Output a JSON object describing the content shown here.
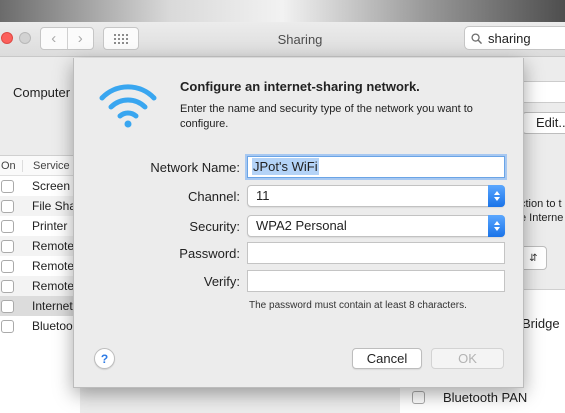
{
  "window": {
    "title": "Sharing",
    "search_value": "sharing"
  },
  "background": {
    "computer_label": "Computer",
    "edit_button": "Edit...",
    "services_header": {
      "on": "On",
      "service": "Service"
    },
    "services": [
      {
        "name": "Screen",
        "checked": false
      },
      {
        "name": "File Sha",
        "checked": false
      },
      {
        "name": "Printer",
        "checked": false
      },
      {
        "name": "Remote",
        "checked": false
      },
      {
        "name": "Remote",
        "checked": false
      },
      {
        "name": "Remote",
        "checked": false
      },
      {
        "name": "Internet",
        "checked": false,
        "selected": true
      },
      {
        "name": "Bluetoo",
        "checked": false
      }
    ],
    "right_text_1": "ction to t",
    "right_text_2": "e Interne",
    "right_list": [
      {
        "label": "Bridge"
      },
      {
        "label": "Bluetooth PAN"
      }
    ]
  },
  "dialog": {
    "title": "Configure an internet-sharing network.",
    "description": "Enter the name and security type of the network you want to configure.",
    "fields": {
      "network_name_label": "Network Name:",
      "network_name_value": "JPot's WiFi",
      "channel_label": "Channel:",
      "channel_value": "11",
      "security_label": "Security:",
      "security_value": "WPA2 Personal",
      "password_label": "Password:",
      "password_value": "",
      "verify_label": "Verify:",
      "verify_value": ""
    },
    "hint": "The password must contain at least 8 characters.",
    "help_label": "?",
    "cancel_label": "Cancel",
    "ok_label": "OK"
  },
  "colors": {
    "accent": "#1a73e8",
    "wifi_icon": "#39a6f0",
    "close_button": "#fc605c"
  },
  "icons": [
    "wifi-icon",
    "search-icon",
    "chevron-left-icon",
    "chevron-right-icon",
    "grid-icon",
    "help-icon",
    "stepper-icon"
  ]
}
